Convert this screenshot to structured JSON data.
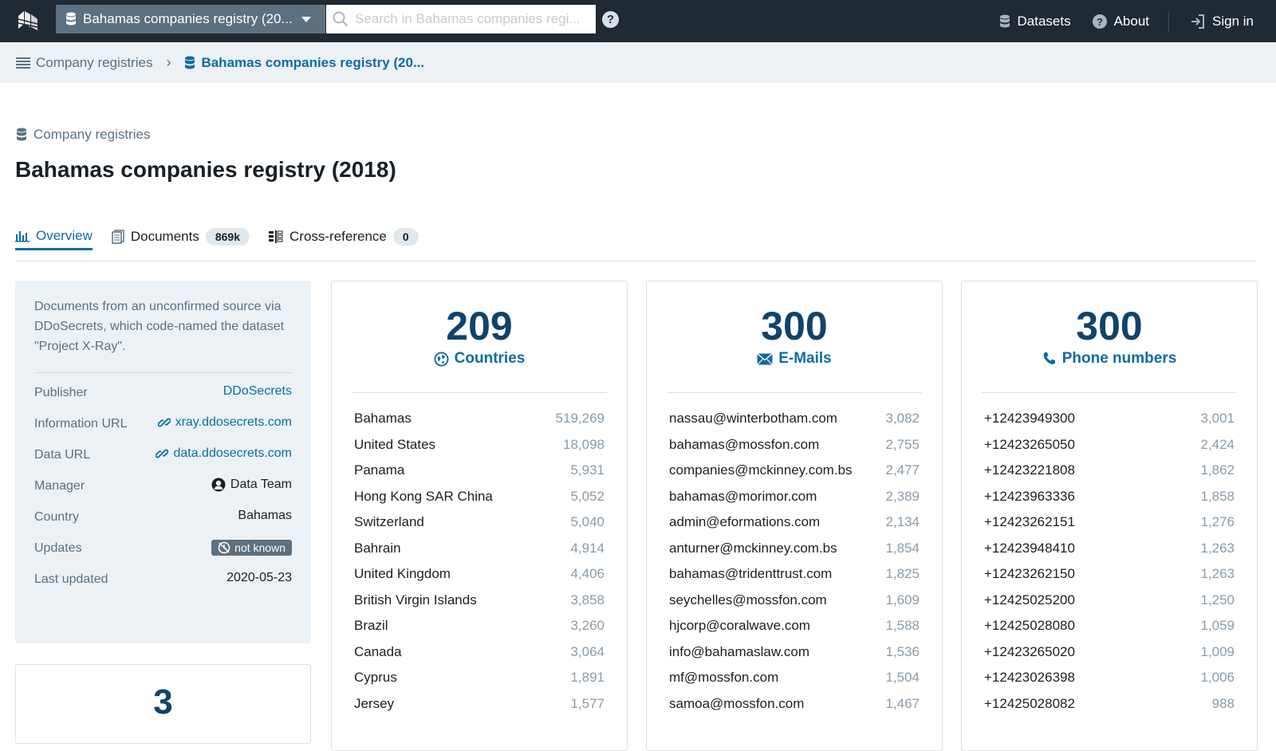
{
  "navbar": {
    "collection_label": "Bahamas companies registry (20...",
    "search_placeholder": "Search in Bahamas companies regi...",
    "help_glyph": "?",
    "datasets_label": "Datasets",
    "about_label": "About",
    "signin_label": "Sign in"
  },
  "breadcrumbs": {
    "parent": "Company registries",
    "current": "Bahamas companies registry (20..."
  },
  "header": {
    "category": "Company registries",
    "title": "Bahamas companies registry (2018)"
  },
  "tabs": [
    {
      "label": "Overview"
    },
    {
      "label": "Documents",
      "count": "869k"
    },
    {
      "label": "Cross-reference",
      "count": "0"
    }
  ],
  "info": {
    "description": "Documents from an unconfirmed source via DDoSecrets, which code-named the dataset \"Project X-Ray\".",
    "publisher_key": "Publisher",
    "publisher_value": "DDoSecrets",
    "info_url_key": "Information URL",
    "info_url_value": "xray.ddosecrets.com",
    "data_url_key": "Data URL",
    "data_url_value": "data.ddosecrets.com",
    "manager_key": "Manager",
    "manager_value": "Data Team",
    "country_key": "Country",
    "country_value": "Bahamas",
    "updates_key": "Updates",
    "updates_value": "not known",
    "last_updated_key": "Last updated",
    "last_updated_value": "2020-05-23"
  },
  "small_card": {
    "number": "3"
  },
  "stats": [
    {
      "number": "209",
      "label": "Countries",
      "icon": "globe-icon",
      "rows": [
        {
          "name": "Bahamas",
          "count": "519,269"
        },
        {
          "name": "United States",
          "count": "18,098"
        },
        {
          "name": "Panama",
          "count": "5,931"
        },
        {
          "name": "Hong Kong SAR China",
          "count": "5,052"
        },
        {
          "name": "Switzerland",
          "count": "5,040"
        },
        {
          "name": "Bahrain",
          "count": "4,914"
        },
        {
          "name": "United Kingdom",
          "count": "4,406"
        },
        {
          "name": "British Virgin Islands",
          "count": "3,858"
        },
        {
          "name": "Brazil",
          "count": "3,260"
        },
        {
          "name": "Canada",
          "count": "3,064"
        },
        {
          "name": "Cyprus",
          "count": "1,891"
        },
        {
          "name": "Jersey",
          "count": "1,577"
        }
      ]
    },
    {
      "number": "300",
      "label": "E-Mails",
      "icon": "envelope-icon",
      "rows": [
        {
          "name": "nassau@winterbotham.com",
          "count": "3,082"
        },
        {
          "name": "bahamas@mossfon.com",
          "count": "2,755"
        },
        {
          "name": "companies@mckinney.com.bs",
          "count": "2,477"
        },
        {
          "name": "bahamas@morimor.com",
          "count": "2,389"
        },
        {
          "name": "admin@eformations.com",
          "count": "2,134"
        },
        {
          "name": "anturner@mckinney.com.bs",
          "count": "1,854"
        },
        {
          "name": "bahamas@tridenttrust.com",
          "count": "1,825"
        },
        {
          "name": "seychelles@mossfon.com",
          "count": "1,609"
        },
        {
          "name": "hjcorp@coralwave.com",
          "count": "1,588"
        },
        {
          "name": "info@bahamaslaw.com",
          "count": "1,536"
        },
        {
          "name": "mf@mossfon.com",
          "count": "1,504"
        },
        {
          "name": "samoa@mossfon.com",
          "count": "1,467"
        }
      ]
    },
    {
      "number": "300",
      "label": "Phone numbers",
      "icon": "phone-icon",
      "rows": [
        {
          "name": "+12423949300",
          "count": "3,001"
        },
        {
          "name": "+12423265050",
          "count": "2,424"
        },
        {
          "name": "+12423221808",
          "count": "1,862"
        },
        {
          "name": "+12423963336",
          "count": "1,858"
        },
        {
          "name": "+12423262151",
          "count": "1,276"
        },
        {
          "name": "+12423948410",
          "count": "1,263"
        },
        {
          "name": "+12423262150",
          "count": "1,263"
        },
        {
          "name": "+12425025200",
          "count": "1,250"
        },
        {
          "name": "+12425028080",
          "count": "1,059"
        },
        {
          "name": "+12423265020",
          "count": "1,009"
        },
        {
          "name": "+12423026398",
          "count": "1,006"
        },
        {
          "name": "+12425028082",
          "count": "988"
        }
      ]
    }
  ]
}
